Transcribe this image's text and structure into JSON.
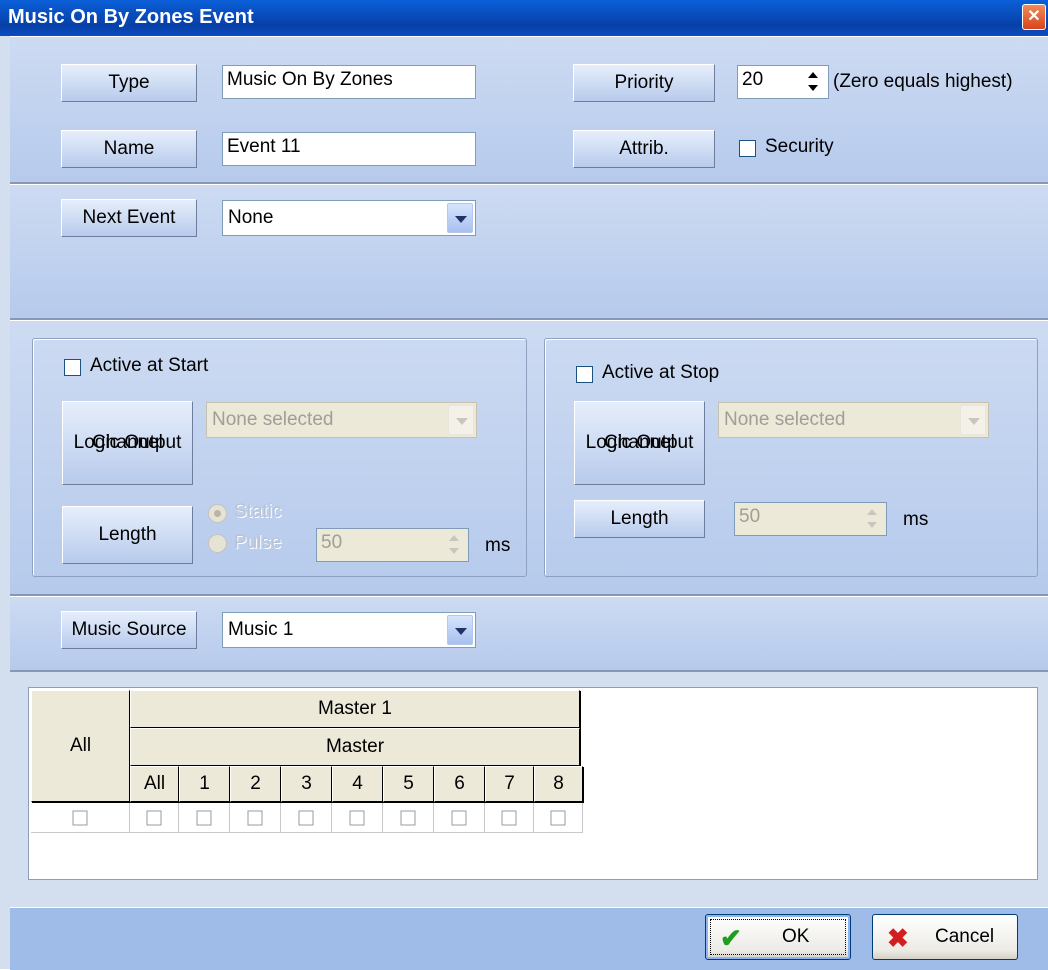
{
  "window": {
    "title": "Music On By Zones Event",
    "close_glyph": "✕"
  },
  "general": {
    "type_label": "Type",
    "type_value": "Music On By Zones",
    "name_label": "Name",
    "name_value": "Event 11",
    "priority_label": "Priority",
    "priority_value": "20",
    "priority_hint": "(Zero equals highest)",
    "attrib_label": "Attrib.",
    "security_label": "Security",
    "security_checked": false
  },
  "next_event": {
    "label": "Next Event",
    "value": "None"
  },
  "start_group": {
    "active_label": "Active at Start",
    "active_checked": false,
    "logic_label_1": "Logic Output",
    "logic_label_2": "Channel",
    "logic_value": "None selected",
    "length_label": "Length",
    "static_label": "Static",
    "pulse_label": "Pulse",
    "selected_mode": "Static",
    "pulse_value": "50",
    "unit": "ms"
  },
  "stop_group": {
    "active_label": "Active at Stop",
    "active_checked": false,
    "logic_label_1": "Logic Output",
    "logic_label_2": "Channel",
    "logic_value": "None selected",
    "length_label": "Length",
    "length_value": "50",
    "unit": "ms"
  },
  "music": {
    "label": "Music Source",
    "value": "Music 1"
  },
  "zone_grid": {
    "all_header": "All",
    "group_header": "Master 1",
    "sub_header": "Master",
    "columns": [
      "All",
      "1",
      "2",
      "3",
      "4",
      "5",
      "6",
      "7",
      "8"
    ],
    "row_checked": [
      false,
      false,
      false,
      false,
      false,
      false,
      false,
      false,
      false,
      false
    ]
  },
  "buttons": {
    "ok_label": "OK",
    "cancel_label": "Cancel",
    "ok_icon": "checkmark-icon",
    "cancel_icon": "x-icon"
  },
  "colors": {
    "titlebar": "#0840a8",
    "panel": "#c6d6f0",
    "footer": "#9fbbe8"
  }
}
